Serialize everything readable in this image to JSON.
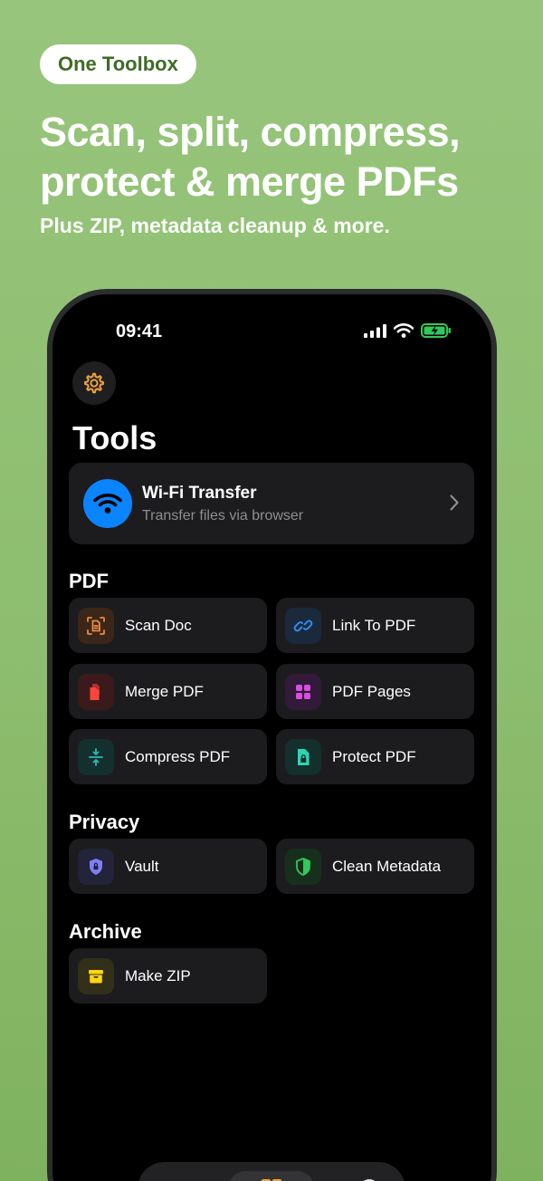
{
  "promo": {
    "pill": "One Toolbox",
    "headline_line1": "Scan, split, compress,",
    "headline_line2": "protect & merge PDFs",
    "subline": "Plus ZIP, metadata cleanup & more."
  },
  "status_bar": {
    "time": "09:41"
  },
  "screen": {
    "title": "Tools",
    "wifi_card": {
      "title": "Wi-Fi Transfer",
      "subtitle": "Transfer files via browser"
    },
    "sections": {
      "pdf": "PDF",
      "privacy": "Privacy",
      "archive": "Archive"
    },
    "tools": {
      "scan_doc": "Scan Doc",
      "link_to_pdf": "Link To PDF",
      "merge_pdf": "Merge PDF",
      "pdf_pages": "PDF Pages",
      "compress_pdf": "Compress PDF",
      "protect_pdf": "Protect PDF",
      "vault": "Vault",
      "clean_metadata": "Clean Metadata",
      "make_zip": "Make ZIP"
    }
  },
  "icons": {
    "settings": "gear-icon",
    "wifi": "wifi-icon",
    "scan_doc": "scan-document-icon",
    "link_to_pdf": "link-icon",
    "merge_pdf": "merge-documents-icon",
    "pdf_pages": "grid-pages-icon",
    "compress_pdf": "compress-icon",
    "protect_pdf": "locked-document-icon",
    "vault": "lock-shield-icon",
    "clean_metadata": "shield-icon",
    "make_zip": "archive-box-icon"
  },
  "colors": {
    "background": "#8dbd6e",
    "pill_text": "#3e6b25",
    "accent_blue": "#0a84ff",
    "gear": "#f2a33a",
    "scan": "#f08a3c",
    "link": "#2f8ae8",
    "merge": "#ff453a",
    "pages": "#d64fe0",
    "compress": "#2bb8b0",
    "protect": "#2ed3b7",
    "vault": "#7d7ff5",
    "clean": "#34c759",
    "zip": "#ffd60a"
  }
}
